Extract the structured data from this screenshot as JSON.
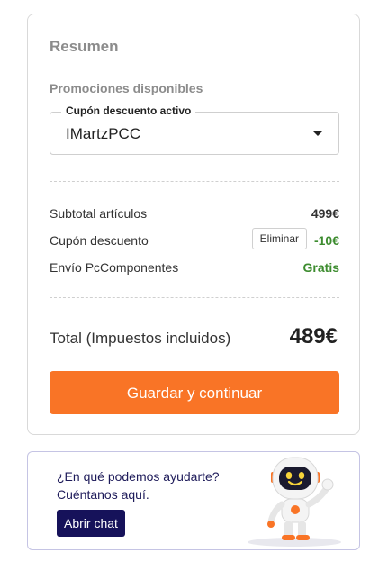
{
  "summary": {
    "title": "Resumen",
    "promotions_label": "Promociones disponibles",
    "coupon_select": {
      "legend": "Cupón descuento activo",
      "value": "IMartzPCC"
    },
    "rows": [
      {
        "label": "Subtotal artículos",
        "value": "499€"
      },
      {
        "label": "Cupón descuento",
        "value": "-10€",
        "remove_label": "Eliminar"
      },
      {
        "label": "Envío PcComponentes",
        "value": "Gratis"
      }
    ],
    "total_label": "Total (Impuestos incluidos)",
    "total_value": "489€",
    "cta_label": "Guardar y continuar"
  },
  "help": {
    "question_line1": "¿En qué podemos ayudarte?",
    "question_line2": "Cuéntanos aquí.",
    "chat_button": "Abrir chat"
  },
  "colors": {
    "accent_orange": "#f97426",
    "discount_green": "#3d8c2f",
    "chat_navy": "#16125a"
  }
}
